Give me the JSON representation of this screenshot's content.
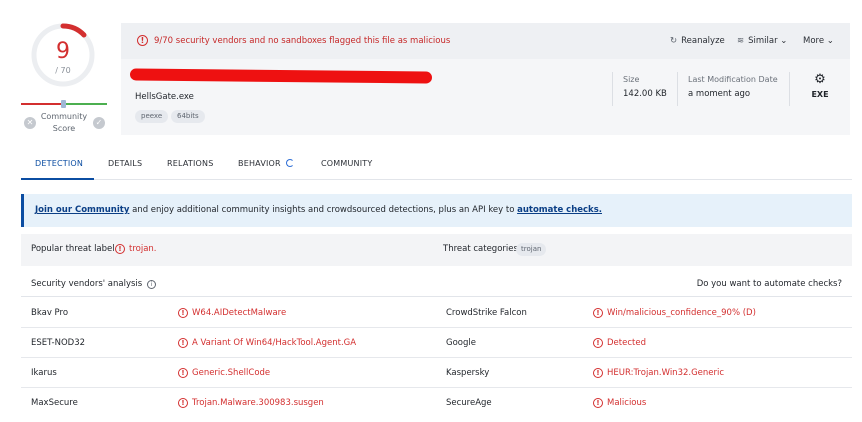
{
  "score": {
    "detections": "9",
    "total": "/ 70",
    "community_label": "Community\nScore",
    "fraction": 0.1286
  },
  "alert": {
    "text": "9/70 security vendors and no sandboxes flagged this file as malicious"
  },
  "actions": {
    "reanalyze": "Reanalyze",
    "similar": "Similar",
    "more": "More"
  },
  "file": {
    "name": "HellsGate.exe",
    "tags": [
      "peexe",
      "64bits"
    ],
    "size_label": "Size",
    "size_value": "142.00 KB",
    "modified_label": "Last Modification Date",
    "modified_value": "a moment ago",
    "type_label": "EXE"
  },
  "tabs": [
    "DETECTION",
    "DETAILS",
    "RELATIONS",
    "BEHAVIOR",
    "COMMUNITY"
  ],
  "banner": {
    "link1": "Join our Community",
    "middle": " and enjoy additional community insights and crowdsourced detections, plus an API key to ",
    "link2": "automate checks."
  },
  "threat": {
    "label": "Popular threat label",
    "value": "trojan.",
    "categories_label": "Threat categories",
    "category": "trojan"
  },
  "vendors": {
    "title": "Security vendors' analysis",
    "automate": "Do you want to automate checks?",
    "rows": [
      {
        "v1": "Bkav Pro",
        "r1": "W64.AIDetectMalware",
        "v2": "CrowdStrike Falcon",
        "r2": "Win/malicious_confidence_90% (D)"
      },
      {
        "v1": "ESET-NOD32",
        "r1": "A Variant Of Win64/HackTool.Agent.GA",
        "v2": "Google",
        "r2": "Detected"
      },
      {
        "v1": "Ikarus",
        "r1": "Generic.ShellCode",
        "v2": "Kaspersky",
        "r2": "HEUR:Trojan.Win32.Generic"
      },
      {
        "v1": "MaxSecure",
        "r1": "Trojan.Malware.300983.susgen",
        "v2": "SecureAge",
        "r2": "Malicious"
      }
    ]
  },
  "colors": {
    "malicious": "#d32f2f",
    "accent": "#0b4da2"
  }
}
